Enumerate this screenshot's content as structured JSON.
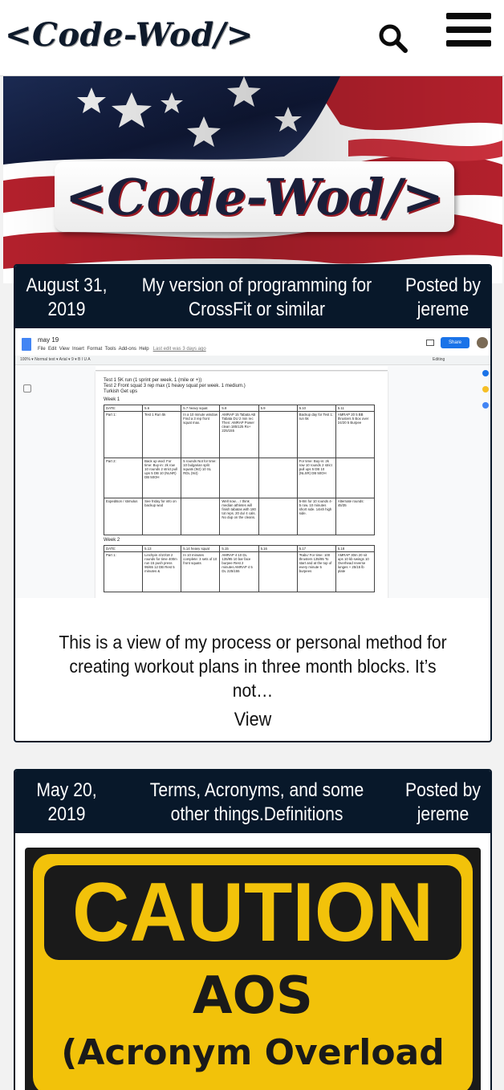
{
  "header": {
    "logo_text": "<Code-Wod/>",
    "search_icon": "search-icon",
    "menu_icon": "hamburger-menu-icon"
  },
  "hero": {
    "logo_text": "<Code-Wod/>",
    "background": "american-flag"
  },
  "posts": [
    {
      "date": "August 31, 2019",
      "title": "My version of programming for CrossFit or similar",
      "author": "Posted by jereme",
      "excerpt": "This is a view of my process or personal method for creating workout plans in three month blocks.  It’s not…",
      "view_label": "View",
      "image": {
        "doc_name": "may 19",
        "menu": [
          "File",
          "Edit",
          "View",
          "Insert",
          "Format",
          "Tools",
          "Add-ons",
          "Help"
        ],
        "last_edit": "Last edit was 3 days ago",
        "share_label": "Share",
        "toolbar": "100%  ▾   Normal text  ▾   Arial  ▾   9  ▾   B  I  U  A",
        "editing_label": "Editing",
        "lines": [
          "Test 1 5K run (1 sprint per week. 1 (mile or +))",
          "Test 2 Front squat 3 rep max (1 heavy squat per week. 1 medium.)",
          "Turkish Get ups"
        ],
        "week1": "Week 1",
        "week2": "Week 2",
        "table1": {
          "header": [
            "DATE:",
            "5.6",
            "5.7 heavy squat",
            "5.8",
            "5.9",
            "5.10",
            "5.11"
          ],
          "rows": [
            [
              "Part 1:",
              "Test 1 Run 5k",
              "In a 10 minute window Find a 3 rep front squat max.",
              "AMRAP 15 Tabata AB Tabata DU 2 min rec Then: AMRAP Power clean 185/125  Rx+ 225/155",
              "",
              "Backup day for Test 1: run 5k",
              "AMRAP 20 5 BB thrusters 5 Box over 24/20 5 Burpee"
            ],
            [
              "Part 2:",
              "Back up wod: For time: Buy-in: 2k row 10 rounds 2 strict pull ups 5 DB 10 (NLNR) DB 50OH",
              "5 rounds Not for time: 10 bulgarian split squats (9ct) 10 SL RDL (9ct)",
              "",
              "",
              "For time: Buy-in: 2k row 10 rounds 2 strict pull ups 5 DB 10 (NLSR) DB 50OH",
              ""
            ],
            [
              "Expedition / stimulus",
              "See friday for info on backup wod",
              "",
              "Well now… I think median athletes will finish tabatas with 180 tot reps. 20 du/ 4 cals. No dup on the cleans.",
              "",
              "5-8m for 10 rounds 4-5 row. 10 minutes short side. 14ish high side.",
              "Alternate rounds: 45/35"
            ]
          ]
        },
        "table2": {
          "header": [
            "DATE:",
            "5.13",
            "5.14 heavy squat",
            "5.15",
            "5.16",
            "5.17",
            "5.18"
          ],
          "rows": [
            [
              "Part 1:",
              "Linchpin 4/10/18 2 rounds for time 400m run 15 push press 95/65 12 DB Rest 5 minutes &",
              "In 10 minutes complete: 3 sets of 10 front squats",
              "AMRAP 4 10 DL 135/95 10 bar face burpee Rest 2 minutes AMRAP 4 5 DL 225/155",
              "",
              "'Rabu' For time: 100 thrusters 135/95 To start and at the top of every minute 5 burpees",
              "AMRAP 30m 20 sit ups 10 kb swings 10 Overhead reverse lunges + 25/15 lb plate"
            ]
          ]
        }
      }
    },
    {
      "date": "May 20, 2019",
      "title": "Terms, Acronyms, and some other things.Definitions",
      "author": "Posted by jereme",
      "image": {
        "sign_line1": "CAUTION",
        "sign_line2": "AOS",
        "sign_line3": "(Acronym Overload"
      }
    }
  ],
  "colors": {
    "card_header_bg": "#08182a",
    "caution_yellow": "#f2c20a",
    "docs_blue": "#1a73e8"
  }
}
